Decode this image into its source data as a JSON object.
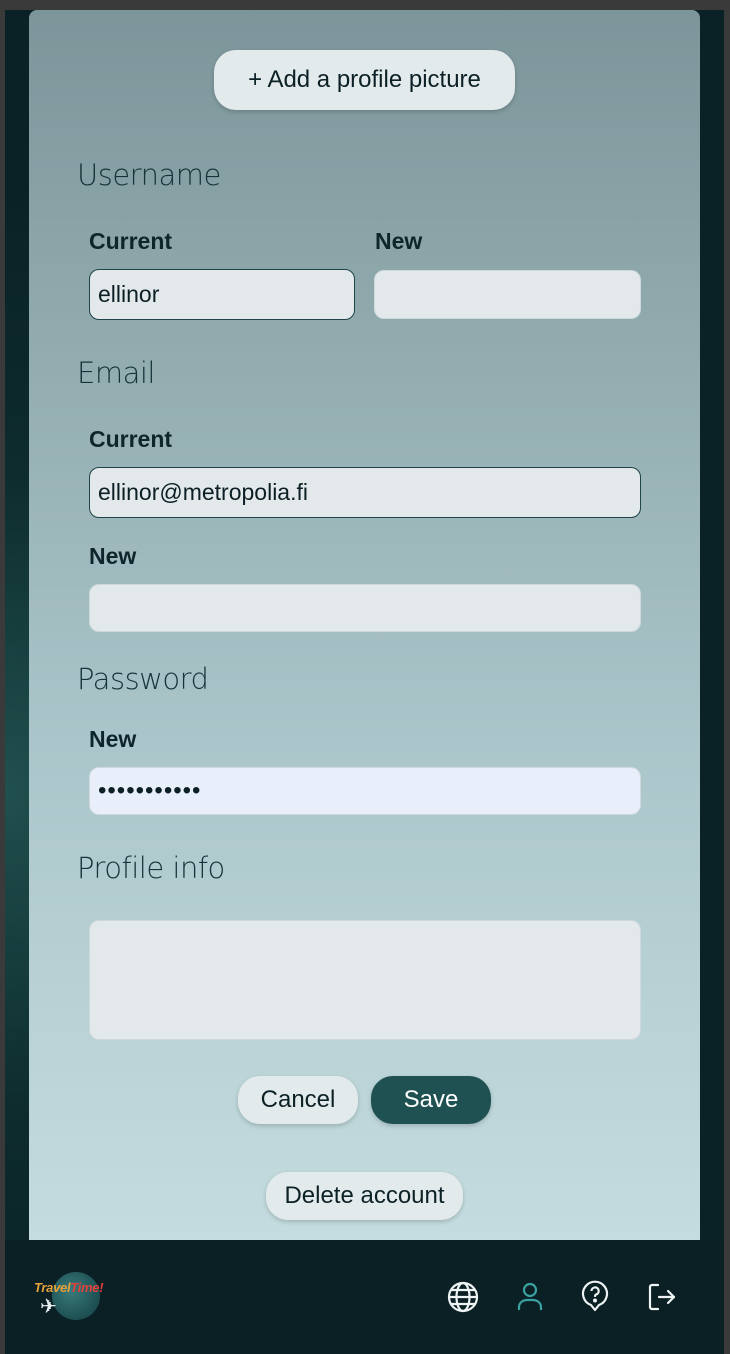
{
  "profile_picture_button": "+ Add a profile picture",
  "username": {
    "title": "Username",
    "current_label": "Current",
    "current_value": "ellinor",
    "new_label": "New",
    "new_value": ""
  },
  "email": {
    "title": "Email",
    "current_label": "Current",
    "current_value": "ellinor@metropolia.fi",
    "new_label": "New",
    "new_value": ""
  },
  "password": {
    "title": "Password",
    "new_label": "New",
    "new_value": "•••••••••••"
  },
  "profile_info": {
    "title": "Profile info",
    "value": ""
  },
  "actions": {
    "cancel": "Cancel",
    "save": "Save",
    "delete": "Delete account"
  },
  "footer": {
    "logo_text_a": "Travel",
    "logo_text_b": "Time!",
    "icons": [
      "globe-icon",
      "user-icon",
      "help-icon",
      "logout-icon"
    ]
  },
  "colors": {
    "accent": "#1f5152",
    "footer_bg": "#0b2025",
    "active_icon": "#3aa0a0"
  }
}
